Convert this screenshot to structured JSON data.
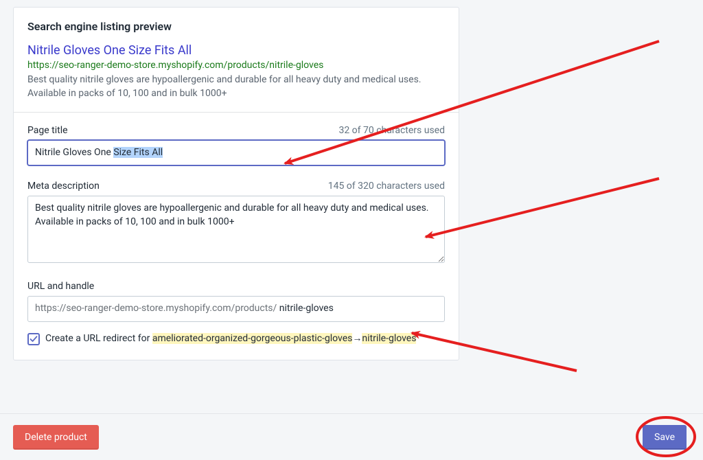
{
  "card": {
    "title": "Search engine listing preview",
    "serp": {
      "title": "Nitrile Gloves One Size Fits All",
      "url": "https://seo-ranger-demo-store.myshopify.com/products/nitrile-gloves",
      "description": "Best quality nitrile gloves are hypoallergenic and durable for all heavy duty and medical uses. Available in packs of 10, 100 and in bulk 1000+"
    }
  },
  "fields": {
    "page_title": {
      "label": "Page title",
      "counter": "32 of 70 characters used",
      "value_prefix": "Nitrile Gloves One ",
      "value_selected": "Size Fits All"
    },
    "meta_description": {
      "label": "Meta description",
      "counter": "145 of 320 characters used",
      "value": "Best quality nitrile gloves are hypoallergenic and durable for all heavy duty and medical uses.  Available in packs of 10, 100 and in bulk 1000+"
    },
    "url_handle": {
      "label": "URL and handle",
      "base": "https://seo-ranger-demo-store.myshopify.com/products/ ",
      "handle": "nitrile-gloves"
    },
    "redirect": {
      "checked": true,
      "prefix": "Create a URL redirect for ",
      "old": "ameliorated-organized-gorgeous-plastic-gloves",
      "arrow": "→",
      "new": "nitrile-gloves"
    }
  },
  "actions": {
    "delete": "Delete product",
    "save": "Save"
  }
}
